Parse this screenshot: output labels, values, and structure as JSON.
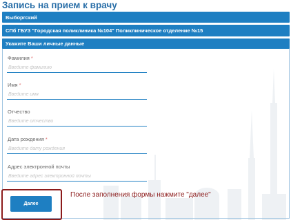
{
  "page": {
    "title": "Запись на прием к врачу"
  },
  "district": {
    "label": "Выборгский"
  },
  "clinic": {
    "label": "СПб ГБУЗ \"Городская поликлиника №104\" Поликлиническое отделение №15"
  },
  "form": {
    "header": "Укажите Ваши личные данные",
    "fields": [
      {
        "label": "Фамилия",
        "required": "*",
        "placeholder": "Введите фамилию",
        "value": ""
      },
      {
        "label": "Имя",
        "required": "*",
        "placeholder": "Введите имя",
        "value": ""
      },
      {
        "label": "Отчество",
        "required": "",
        "placeholder": "Введите отчество",
        "value": ""
      },
      {
        "label": "Дата рождения",
        "required": "*",
        "placeholder": "Введите дату рождения",
        "value": ""
      },
      {
        "label": "Адрес электронной почты",
        "required": "",
        "placeholder": "Введите адрес электронной почты",
        "value": ""
      }
    ],
    "next_label": "Далее"
  },
  "annotation": {
    "hint": "После заполнения формы нажмите \"далее\""
  },
  "colors": {
    "accent": "#1e7fc2",
    "title": "#2a6fa8",
    "highlight": "#8b1a1a"
  }
}
